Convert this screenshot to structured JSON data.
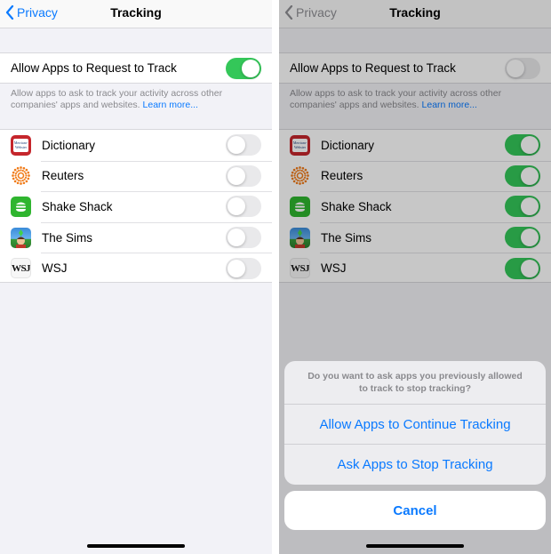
{
  "left": {
    "nav": {
      "back_label": "Privacy",
      "title": "Tracking"
    },
    "main_toggle": {
      "label": "Allow Apps to Request to Track",
      "on": true
    },
    "footer": {
      "text": "Allow apps to ask to track your activity across other companies' apps and websites.",
      "link": "Learn more..."
    },
    "apps": [
      {
        "name": "Dictionary",
        "icon": "dictionary-icon",
        "on": false
      },
      {
        "name": "Reuters",
        "icon": "reuters-icon",
        "on": false
      },
      {
        "name": "Shake Shack",
        "icon": "shake-shack-icon",
        "on": false
      },
      {
        "name": "The Sims",
        "icon": "the-sims-icon",
        "on": false
      },
      {
        "name": "WSJ",
        "icon": "wsj-icon",
        "on": false
      }
    ]
  },
  "right": {
    "nav": {
      "back_label": "Privacy",
      "title": "Tracking"
    },
    "main_toggle": {
      "label": "Allow Apps to Request to Track",
      "on": false
    },
    "footer": {
      "text": "Allow apps to ask to track your activity across other companies' apps and websites.",
      "link": "Learn more..."
    },
    "apps": [
      {
        "name": "Dictionary",
        "icon": "dictionary-icon",
        "on": true
      },
      {
        "name": "Reuters",
        "icon": "reuters-icon",
        "on": true
      },
      {
        "name": "Shake Shack",
        "icon": "shake-shack-icon",
        "on": true
      },
      {
        "name": "The Sims",
        "icon": "the-sims-icon",
        "on": true
      },
      {
        "name": "WSJ",
        "icon": "wsj-icon",
        "on": true
      }
    ],
    "sheet": {
      "message": "Do you want to ask apps you previously allowed to track to stop tracking?",
      "action_continue": "Allow Apps to Continue Tracking",
      "action_stop": "Ask Apps to Stop Tracking",
      "cancel": "Cancel"
    }
  },
  "icon_text": {
    "wsj": "WSJ",
    "dictionary": "Merriam-Webster"
  },
  "colors": {
    "accent": "#0a7aff",
    "toggle_on": "#34c759",
    "toggle_off": "#e9e9eb"
  }
}
